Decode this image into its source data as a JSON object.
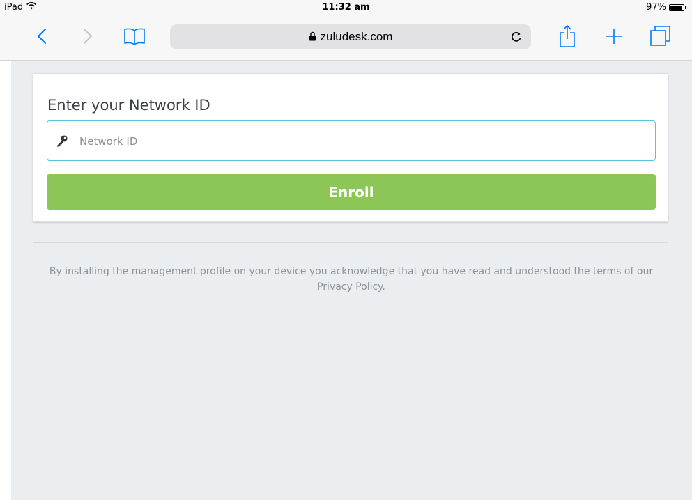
{
  "status_bar": {
    "device": "iPad",
    "time": "11:32 am",
    "battery_text": "97%",
    "battery_level": 0.97
  },
  "toolbar": {
    "url": "zuludesk.com",
    "icons": {
      "back": "chevron-left-icon",
      "forward": "chevron-right-icon",
      "bookmarks": "book-icon",
      "reload": "reload-icon",
      "share": "share-icon",
      "new_tab": "plus-icon",
      "tabs": "tabs-icon",
      "lock": "lock-icon"
    }
  },
  "form": {
    "title": "Enter your Network ID",
    "input_placeholder": "Network ID",
    "input_value": "",
    "submit_label": "Enroll"
  },
  "footer": {
    "disclaimer": "By installing the management profile on your device you acknowledge that you have read and understood the terms of our Privacy Policy."
  },
  "colors": {
    "accent_blue": "#007aff",
    "enroll_green": "#8cc656",
    "input_focus_border": "#53c7d9",
    "page_background": "#ebeef0"
  }
}
